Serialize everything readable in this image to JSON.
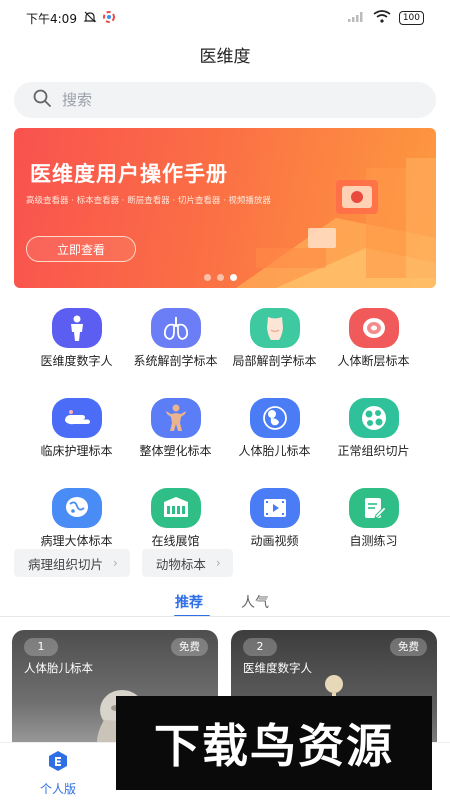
{
  "status_bar": {
    "time": "下午4:09",
    "battery": "100"
  },
  "header": {
    "title": "医维度"
  },
  "search": {
    "placeholder": "搜索"
  },
  "banner": {
    "title": "医维度用户操作手册",
    "subtitle": "高级查看器 · 标本查看器 · 断层查看器 · 切片查看器 · 视频播放器",
    "button_label": "立即查看",
    "slide_count": 3,
    "active_slide": 3
  },
  "categories": [
    {
      "label": "医维度数字人",
      "icon": "digital-human-icon",
      "color": "#5b5ef0"
    },
    {
      "label": "系统解剖学标本",
      "icon": "lungs-icon",
      "color": "#6b7ef5"
    },
    {
      "label": "局部解剖学标本",
      "icon": "torso-icon",
      "color": "#3fc9a0"
    },
    {
      "label": "人体断层标本",
      "icon": "cross-section-icon",
      "color": "#f05a5a"
    },
    {
      "label": "临床护理标本",
      "icon": "hand-icon",
      "color": "#4a6cf7"
    },
    {
      "label": "整体塑化标本",
      "icon": "plastinated-body-icon",
      "color": "#5b7ef7"
    },
    {
      "label": "人体胎儿标本",
      "icon": "fetus-icon",
      "color": "#4a7cf5"
    },
    {
      "label": "正常组织切片",
      "icon": "tissue-slice-icon",
      "color": "#2fc29a"
    },
    {
      "label": "病理大体标本",
      "icon": "pathology-icon",
      "color": "#4a8cf5"
    },
    {
      "label": "在线展馆",
      "icon": "museum-icon",
      "color": "#2fbf86"
    },
    {
      "label": "动画视频",
      "icon": "video-icon",
      "color": "#4a7cf5"
    },
    {
      "label": "自测练习",
      "icon": "quiz-icon",
      "color": "#2fbf86"
    }
  ],
  "chips": [
    {
      "label": "病理组织切片"
    },
    {
      "label": "动物标本"
    }
  ],
  "tabs": [
    {
      "label": "推荐",
      "active": true
    },
    {
      "label": "人气",
      "active": false
    }
  ],
  "cards": [
    {
      "rank": "1",
      "badge": "免费",
      "title": "人体胎儿标本"
    },
    {
      "rank": "2",
      "badge": "免费",
      "title": "医维度数字人"
    }
  ],
  "bottom_nav": {
    "label": "个人版"
  },
  "watermark": {
    "text": "下载鸟资源"
  },
  "colors": {
    "accent": "#2f6fe6",
    "banner_start": "#f9524f",
    "banner_end": "#fd9b3f"
  }
}
